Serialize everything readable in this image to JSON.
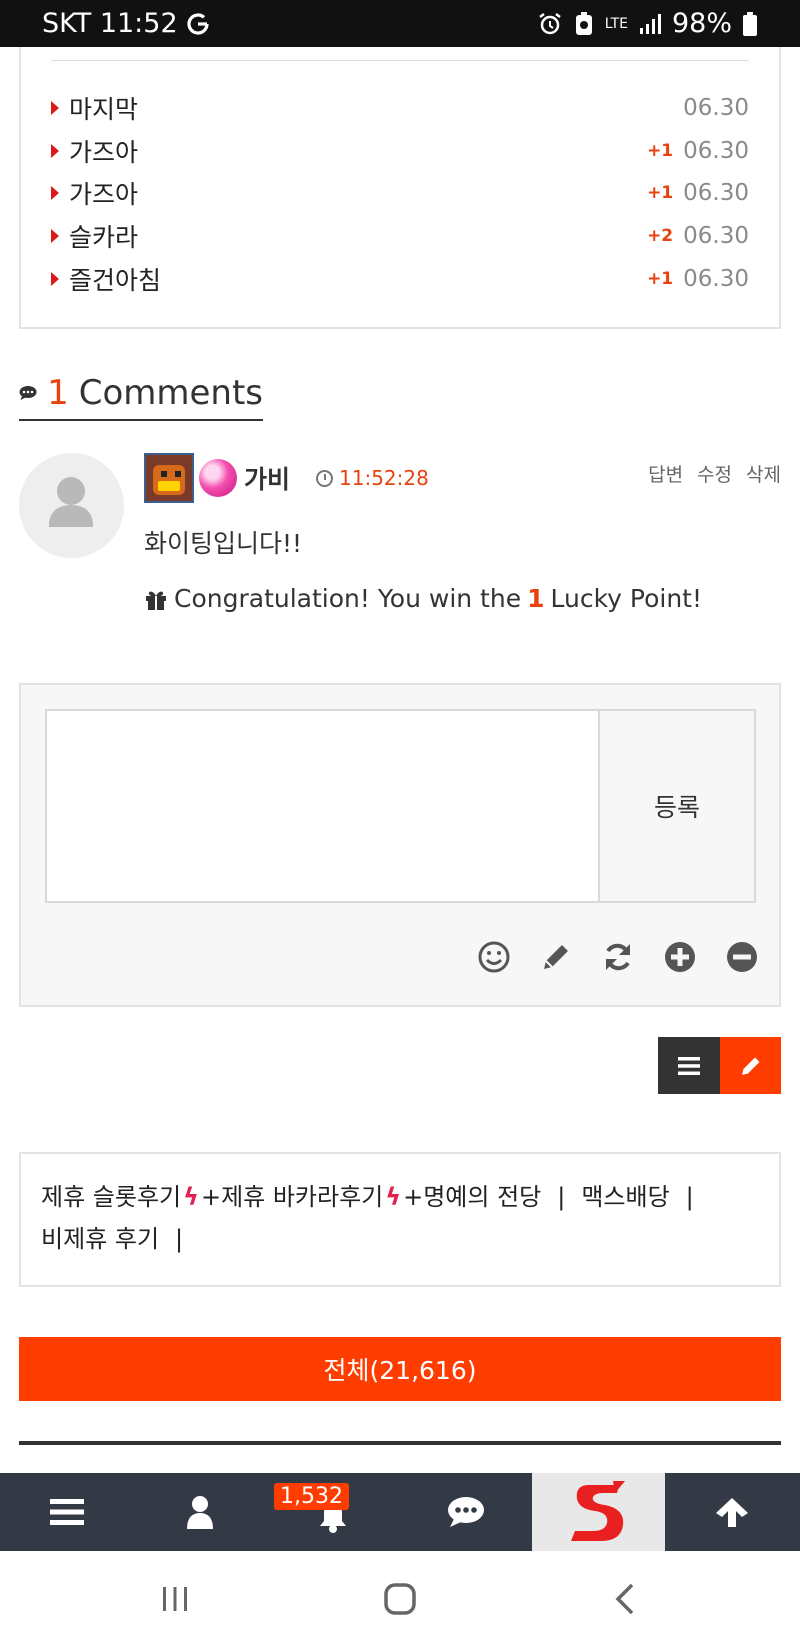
{
  "status_bar": {
    "carrier_time": "SKT 11:52",
    "signal": "LTE",
    "battery": "98%"
  },
  "related_posts": [
    {
      "title": "마지막",
      "badge": "",
      "date": "06.30"
    },
    {
      "title": "가즈아",
      "badge": "+1",
      "date": "06.30"
    },
    {
      "title": "가즈아",
      "badge": "+1",
      "date": "06.30"
    },
    {
      "title": "슬카라",
      "badge": "+2",
      "date": "06.30"
    },
    {
      "title": "즐건아침",
      "badge": "+1",
      "date": "06.30"
    }
  ],
  "comments": {
    "count": "1",
    "label": "Comments",
    "items": [
      {
        "nickname": "가비",
        "time": "11:52:28",
        "actions": {
          "reply": "답변",
          "edit": "수정",
          "delete": "삭제"
        },
        "text": "화이팅입니다!!",
        "lucky_prefix": "Congratulation! You win the",
        "lucky_points": "1",
        "lucky_suffix": "Lucky Point!"
      }
    ]
  },
  "comment_form": {
    "submit_label": "등록",
    "textarea_value": ""
  },
  "categories": {
    "item1": "제휴 슬롯후기",
    "item2": "+제휴 바카라후기",
    "item3": "+명예의 전당",
    "item4": "맥스배당",
    "item5": "비제휴 후기",
    "separator": "|"
  },
  "total_button": "전체(21,616)",
  "bottom_nav": {
    "notification_count": "1,532"
  },
  "colors": {
    "accent": "#ff3d00",
    "nav_bg": "#333a45",
    "list_button": "#333333"
  }
}
